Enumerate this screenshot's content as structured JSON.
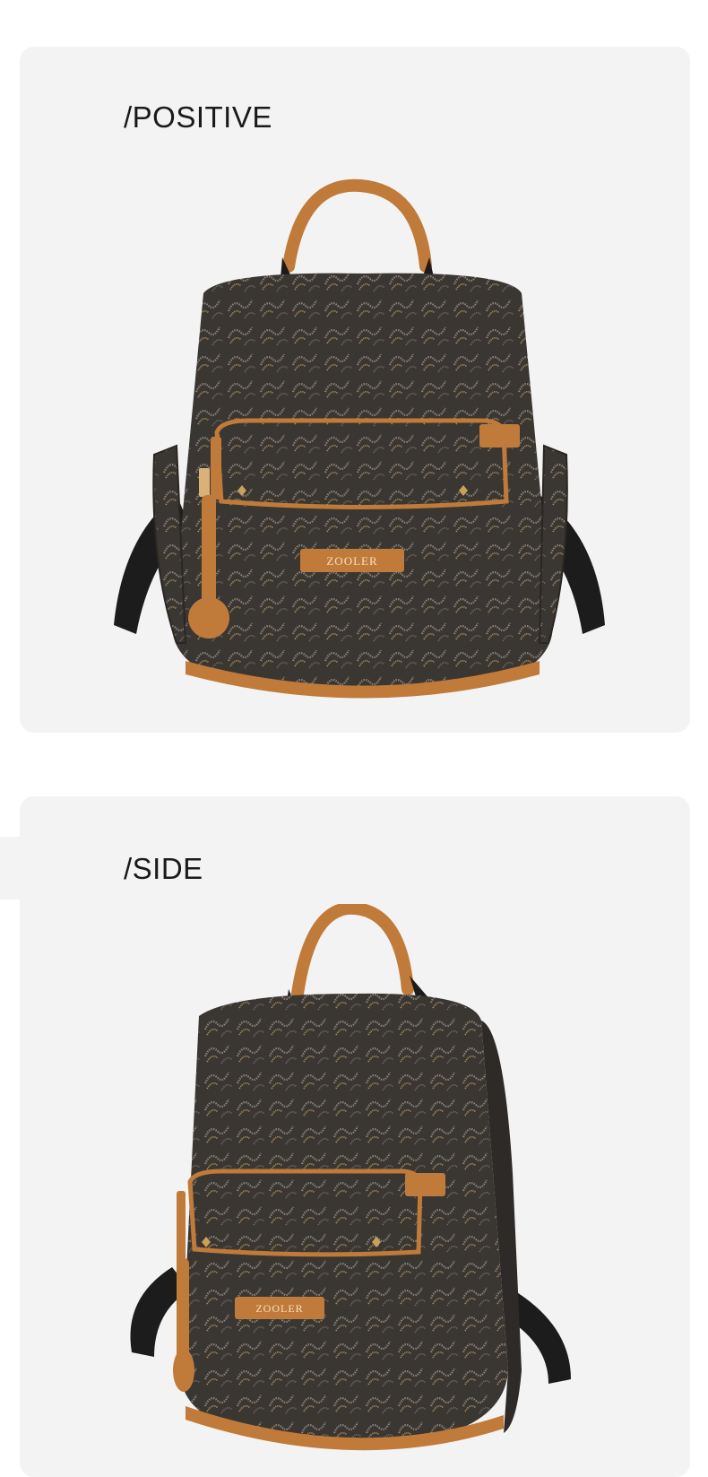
{
  "sections": [
    {
      "label": "/POSITIVE",
      "view": "front",
      "logo_text": "ZOOLER"
    },
    {
      "label": "/SIDE",
      "view": "side",
      "logo_text": "ZOOLER"
    }
  ],
  "colors": {
    "panel_bg": "#f3f3f3",
    "fabric": "#3a3632",
    "leather": "#c07a3a",
    "strap": "#1c1c1c",
    "text": "#1a1a1a"
  }
}
